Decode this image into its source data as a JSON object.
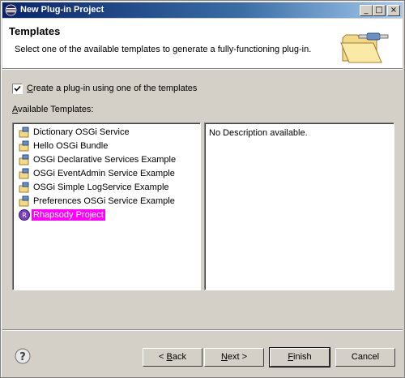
{
  "window": {
    "title": "New Plug-in Project"
  },
  "titlebar_buttons": {
    "minimize": "_",
    "maximize": "□",
    "close": "×"
  },
  "header": {
    "title": "Templates",
    "description": "Select one of the available templates to generate a fully-functioning plug-in."
  },
  "options": {
    "create_from_template": {
      "label": "reate a plug-in using one of the templates",
      "mnemonic": "C",
      "checked": true
    }
  },
  "templates": {
    "label_mnemonic": "A",
    "label": "vailable Templates:",
    "items": [
      {
        "label": "Dictionary OSGi Service",
        "icon": "template-icon"
      },
      {
        "label": "Hello OSGi Bundle",
        "icon": "template-icon"
      },
      {
        "label": "OSGi Declarative Services Example",
        "icon": "template-icon"
      },
      {
        "label": "OSGi EventAdmin Service Example",
        "icon": "template-icon"
      },
      {
        "label": "OSGi Simple LogService Example",
        "icon": "template-icon"
      },
      {
        "label": "Preferences OSGi Service Example",
        "icon": "template-icon"
      },
      {
        "label": "Rhapsody Project",
        "icon": "rhapsody-icon",
        "selected": true
      }
    ]
  },
  "description_panel": {
    "text": "No Description available."
  },
  "buttons": {
    "back": {
      "prefix": "< ",
      "mnemonic": "B",
      "rest": "ack"
    },
    "next": {
      "mnemonic": "N",
      "rest": "ext >"
    },
    "finish": {
      "mnemonic": "F",
      "rest": "inish"
    },
    "cancel": {
      "label": "Cancel"
    }
  },
  "colors": {
    "selection": "#ff00ff",
    "dialog_bg": "#d4d0c8",
    "title_gradient_start": "#0a246a"
  }
}
